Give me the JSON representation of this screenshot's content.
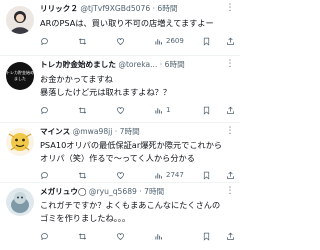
{
  "posts": [
    {
      "name": "リリック２",
      "handle": "@tjTvf9XGBd5076",
      "time": "6時間",
      "lines": [
        "ARのPSAは、買い取り不可の店増えてますよー"
      ],
      "views": "2609"
    },
    {
      "name": "トレカ貯金始めました",
      "handle": "@toreka...",
      "time": "6時間",
      "avatar_text": "トレカ貯金始めました",
      "lines": [
        "お金かかってますね",
        "暴落したけど元は取れますよね？？"
      ],
      "views": "1"
    },
    {
      "name": "マインス",
      "handle": "@mwa98jj",
      "time": "7時間",
      "lines": [
        "PSA10オリパの最低保証ar爆死か際元でこれから",
        "オリパ（笑）作るで～ってく人から分かる"
      ],
      "views": "2747"
    },
    {
      "name": "メガリュウ◯",
      "handle": "@ryu_q5689",
      "time": "7時間",
      "lines": [
        "これガチですか？よくもまあこんなにたくさんの",
        "ゴミを作りましたね。。。"
      ],
      "views": ""
    }
  ],
  "colors": {
    "text": "#0f1419",
    "muted": "#536471",
    "divider": "#eff3f4"
  },
  "icons": [
    "reply-icon",
    "retweet-icon",
    "like-icon",
    "views-icon",
    "bookmark-icon",
    "share-icon",
    "more-icon"
  ]
}
